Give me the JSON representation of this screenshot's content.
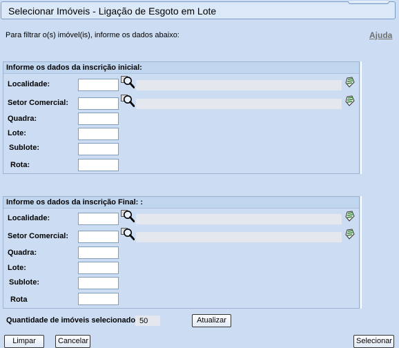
{
  "window": {
    "title": "Selecionar Imóveis - Ligação de Esgoto em Lote"
  },
  "intro": {
    "text": "Para filtrar o(s) imóvel(is), informe os dados abaixo:",
    "help_link": "Ajuda"
  },
  "initial": {
    "header": "Informe os dados da inscrição inicial:",
    "localidade_label": "Localidade:",
    "setor_label": "Setor Comercial:",
    "quadra_label": "Quadra:",
    "lote_label": "Lote:",
    "sublote_label": "Sublote:",
    "rota_label": "Rota:",
    "localidade_value": "",
    "setor_value": "",
    "quadra_value": "",
    "lote_value": "",
    "sublote_value": "",
    "rota_value": ""
  },
  "final": {
    "header": "Informe os dados da inscrição Final: :",
    "localidade_label": "Localidade:",
    "setor_label": "Setor Comercial:",
    "quadra_label": "Quadra:",
    "lote_label": "Lote:",
    "sublote_label": "Sublote:",
    "rota_label": "Rota",
    "localidade_value": "",
    "setor_value": "",
    "quadra_value": "",
    "lote_value": "",
    "sublote_value": "",
    "rota_value": ""
  },
  "quantity": {
    "label": "Quantidade de imóveis selecionados:",
    "value": "50",
    "update_button": "Atualizar"
  },
  "actions": {
    "clear_button": "Limpar",
    "cancel_button": "Cancelar",
    "select_button": "Selecionar"
  },
  "icons": {
    "search": "magnifier-search-icon",
    "erase": "eraser-clear-icon"
  },
  "colors": {
    "background": "#ccddf3",
    "header": "#c0d5ee",
    "readonly_field": "#e4e8ee"
  }
}
